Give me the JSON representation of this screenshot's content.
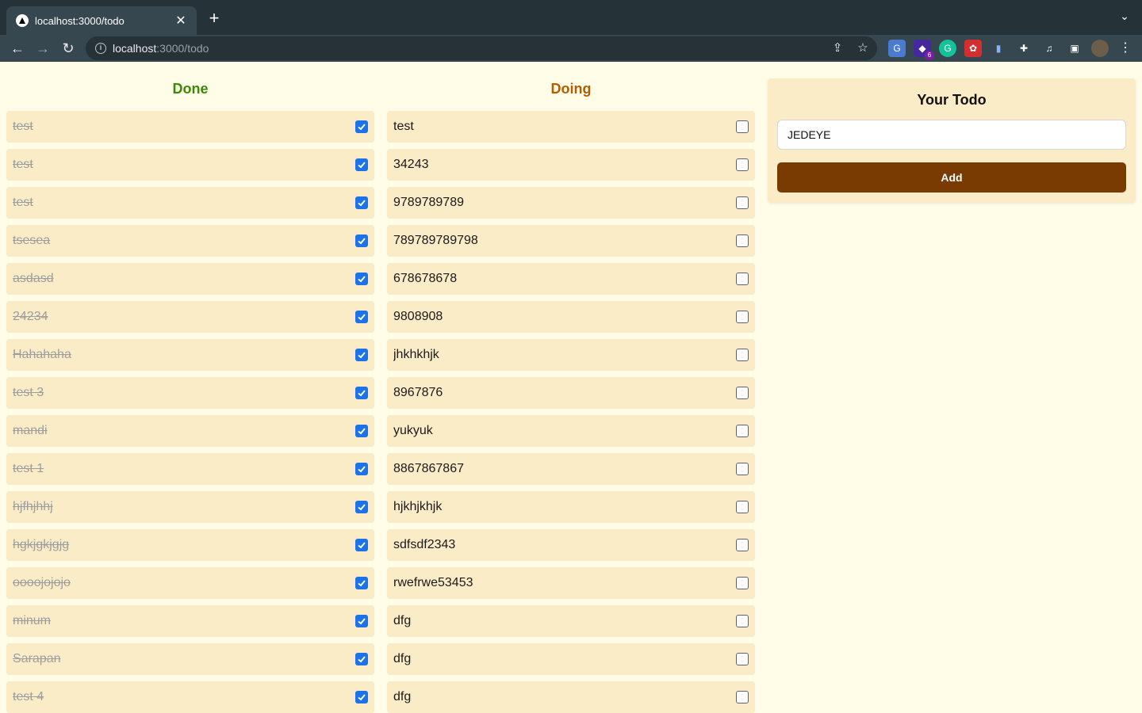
{
  "browser": {
    "tab_title": "localhost:3000/todo",
    "url_host": "localhost",
    "url_path": ":3000/todo",
    "new_tab_label": "+",
    "close_label": "✕"
  },
  "columns": {
    "done_title": "Done",
    "doing_title": "Doing"
  },
  "done_items": [
    "test",
    "test",
    "test",
    "tsesea",
    "asdasd",
    "24234",
    "Hahahaha",
    "test 3",
    "mandi",
    "test 1",
    "hjfhjhhj",
    "hgkjgkjgjg",
    "oooojojojo",
    "minum",
    "Sarapan",
    "test 4"
  ],
  "doing_items": [
    "test",
    "34243",
    "9789789789",
    "789789789798",
    "678678678",
    "9808908",
    "jhkhkhjk",
    "8967876",
    "yukyuk",
    "8867867867",
    "hjkhjkhjk",
    "sdfsdf2343",
    "rwefrwe53453",
    "dfg",
    "dfg",
    "dfg"
  ],
  "form": {
    "title": "Your Todo",
    "input_value": "JEDEYE",
    "add_label": "Add"
  },
  "extensions": {
    "badge_count": "6"
  },
  "colors": {
    "done_title": "#3b8a03",
    "doing_title": "#b35c00",
    "add_button": "#7a3b02",
    "item_bg": "#fbecc8",
    "page_bg": "#fffde7"
  }
}
